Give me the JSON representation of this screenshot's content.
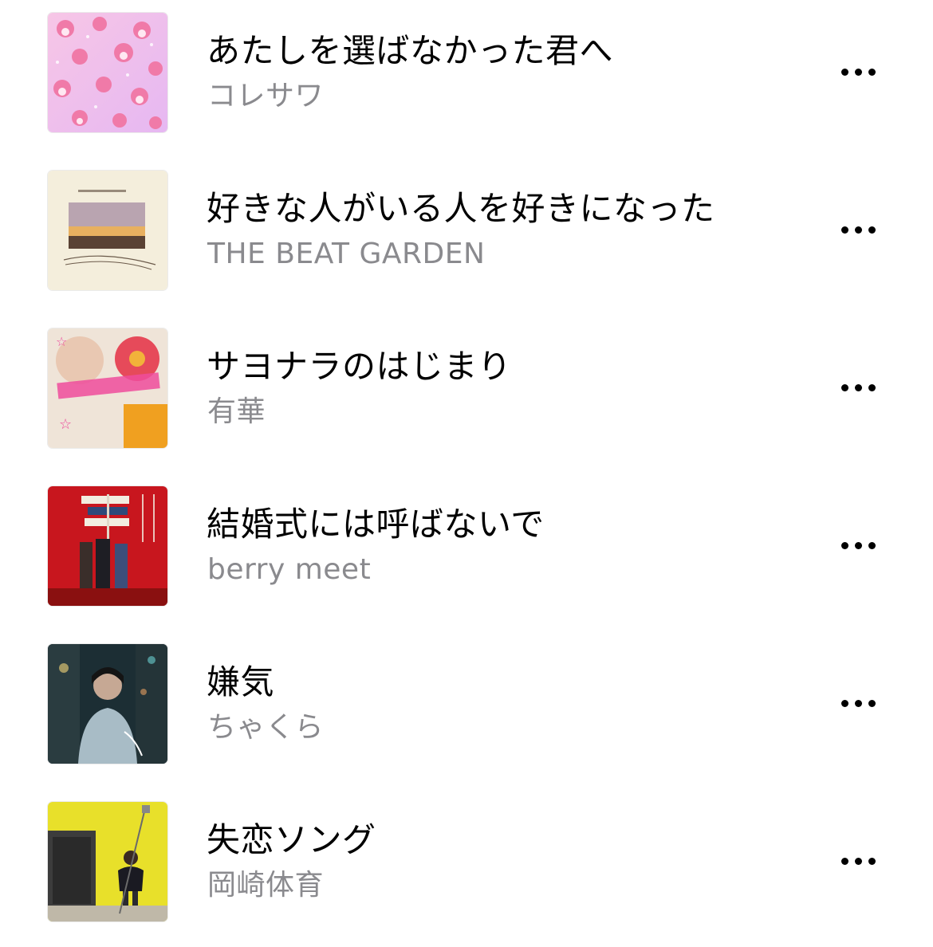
{
  "songs": [
    {
      "title": "あたしを選ばなかった君へ",
      "artist": "コレサワ",
      "artwork": "artwork-pink-characters"
    },
    {
      "title": "好きな人がいる人を好きになった",
      "artist": "THE BEAT GARDEN",
      "artwork": "artwork-sunset-photo"
    },
    {
      "title": "サヨナラのはじまり",
      "artist": "有華",
      "artwork": "artwork-stamp-rally"
    },
    {
      "title": "結婚式には呼ばないで",
      "artist": "berry meet",
      "artwork": "artwork-red-band-photo"
    },
    {
      "title": "嫌気",
      "artist": "ちゃくら",
      "artwork": "artwork-night-street-portrait"
    },
    {
      "title": "失恋ソング",
      "artist": "岡崎体育",
      "artwork": "artwork-yellow-wall-photo"
    }
  ],
  "more_icon": "ellipsis-icon"
}
